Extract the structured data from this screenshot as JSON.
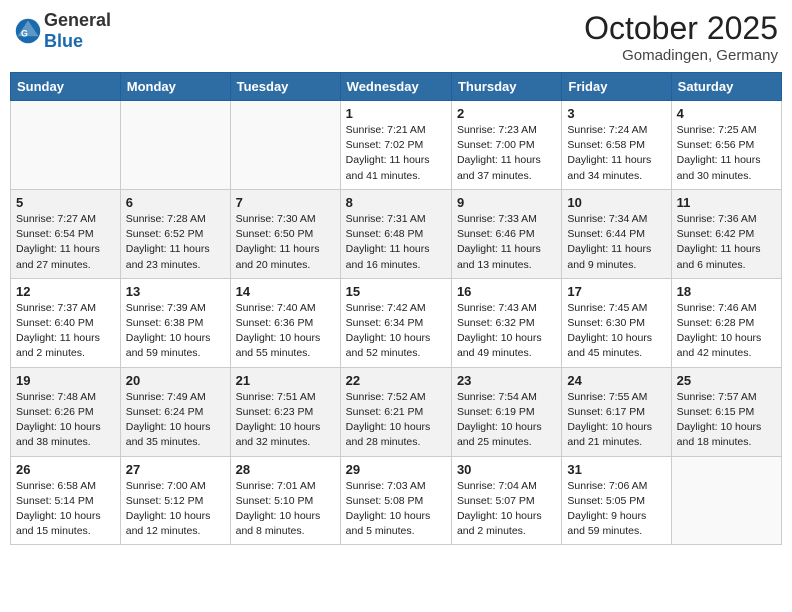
{
  "header": {
    "logo_general": "General",
    "logo_blue": "Blue",
    "month": "October 2025",
    "location": "Gomadingen, Germany"
  },
  "weekdays": [
    "Sunday",
    "Monday",
    "Tuesday",
    "Wednesday",
    "Thursday",
    "Friday",
    "Saturday"
  ],
  "weeks": [
    {
      "days": [
        {
          "num": "",
          "info": ""
        },
        {
          "num": "",
          "info": ""
        },
        {
          "num": "",
          "info": ""
        },
        {
          "num": "1",
          "info": "Sunrise: 7:21 AM\nSunset: 7:02 PM\nDaylight: 11 hours\nand 41 minutes."
        },
        {
          "num": "2",
          "info": "Sunrise: 7:23 AM\nSunset: 7:00 PM\nDaylight: 11 hours\nand 37 minutes."
        },
        {
          "num": "3",
          "info": "Sunrise: 7:24 AM\nSunset: 6:58 PM\nDaylight: 11 hours\nand 34 minutes."
        },
        {
          "num": "4",
          "info": "Sunrise: 7:25 AM\nSunset: 6:56 PM\nDaylight: 11 hours\nand 30 minutes."
        }
      ],
      "shaded": false
    },
    {
      "days": [
        {
          "num": "5",
          "info": "Sunrise: 7:27 AM\nSunset: 6:54 PM\nDaylight: 11 hours\nand 27 minutes."
        },
        {
          "num": "6",
          "info": "Sunrise: 7:28 AM\nSunset: 6:52 PM\nDaylight: 11 hours\nand 23 minutes."
        },
        {
          "num": "7",
          "info": "Sunrise: 7:30 AM\nSunset: 6:50 PM\nDaylight: 11 hours\nand 20 minutes."
        },
        {
          "num": "8",
          "info": "Sunrise: 7:31 AM\nSunset: 6:48 PM\nDaylight: 11 hours\nand 16 minutes."
        },
        {
          "num": "9",
          "info": "Sunrise: 7:33 AM\nSunset: 6:46 PM\nDaylight: 11 hours\nand 13 minutes."
        },
        {
          "num": "10",
          "info": "Sunrise: 7:34 AM\nSunset: 6:44 PM\nDaylight: 11 hours\nand 9 minutes."
        },
        {
          "num": "11",
          "info": "Sunrise: 7:36 AM\nSunset: 6:42 PM\nDaylight: 11 hours\nand 6 minutes."
        }
      ],
      "shaded": true
    },
    {
      "days": [
        {
          "num": "12",
          "info": "Sunrise: 7:37 AM\nSunset: 6:40 PM\nDaylight: 11 hours\nand 2 minutes."
        },
        {
          "num": "13",
          "info": "Sunrise: 7:39 AM\nSunset: 6:38 PM\nDaylight: 10 hours\nand 59 minutes."
        },
        {
          "num": "14",
          "info": "Sunrise: 7:40 AM\nSunset: 6:36 PM\nDaylight: 10 hours\nand 55 minutes."
        },
        {
          "num": "15",
          "info": "Sunrise: 7:42 AM\nSunset: 6:34 PM\nDaylight: 10 hours\nand 52 minutes."
        },
        {
          "num": "16",
          "info": "Sunrise: 7:43 AM\nSunset: 6:32 PM\nDaylight: 10 hours\nand 49 minutes."
        },
        {
          "num": "17",
          "info": "Sunrise: 7:45 AM\nSunset: 6:30 PM\nDaylight: 10 hours\nand 45 minutes."
        },
        {
          "num": "18",
          "info": "Sunrise: 7:46 AM\nSunset: 6:28 PM\nDaylight: 10 hours\nand 42 minutes."
        }
      ],
      "shaded": false
    },
    {
      "days": [
        {
          "num": "19",
          "info": "Sunrise: 7:48 AM\nSunset: 6:26 PM\nDaylight: 10 hours\nand 38 minutes."
        },
        {
          "num": "20",
          "info": "Sunrise: 7:49 AM\nSunset: 6:24 PM\nDaylight: 10 hours\nand 35 minutes."
        },
        {
          "num": "21",
          "info": "Sunrise: 7:51 AM\nSunset: 6:23 PM\nDaylight: 10 hours\nand 32 minutes."
        },
        {
          "num": "22",
          "info": "Sunrise: 7:52 AM\nSunset: 6:21 PM\nDaylight: 10 hours\nand 28 minutes."
        },
        {
          "num": "23",
          "info": "Sunrise: 7:54 AM\nSunset: 6:19 PM\nDaylight: 10 hours\nand 25 minutes."
        },
        {
          "num": "24",
          "info": "Sunrise: 7:55 AM\nSunset: 6:17 PM\nDaylight: 10 hours\nand 21 minutes."
        },
        {
          "num": "25",
          "info": "Sunrise: 7:57 AM\nSunset: 6:15 PM\nDaylight: 10 hours\nand 18 minutes."
        }
      ],
      "shaded": true
    },
    {
      "days": [
        {
          "num": "26",
          "info": "Sunrise: 6:58 AM\nSunset: 5:14 PM\nDaylight: 10 hours\nand 15 minutes."
        },
        {
          "num": "27",
          "info": "Sunrise: 7:00 AM\nSunset: 5:12 PM\nDaylight: 10 hours\nand 12 minutes."
        },
        {
          "num": "28",
          "info": "Sunrise: 7:01 AM\nSunset: 5:10 PM\nDaylight: 10 hours\nand 8 minutes."
        },
        {
          "num": "29",
          "info": "Sunrise: 7:03 AM\nSunset: 5:08 PM\nDaylight: 10 hours\nand 5 minutes."
        },
        {
          "num": "30",
          "info": "Sunrise: 7:04 AM\nSunset: 5:07 PM\nDaylight: 10 hours\nand 2 minutes."
        },
        {
          "num": "31",
          "info": "Sunrise: 7:06 AM\nSunset: 5:05 PM\nDaylight: 9 hours\nand 59 minutes."
        },
        {
          "num": "",
          "info": ""
        }
      ],
      "shaded": false
    }
  ]
}
